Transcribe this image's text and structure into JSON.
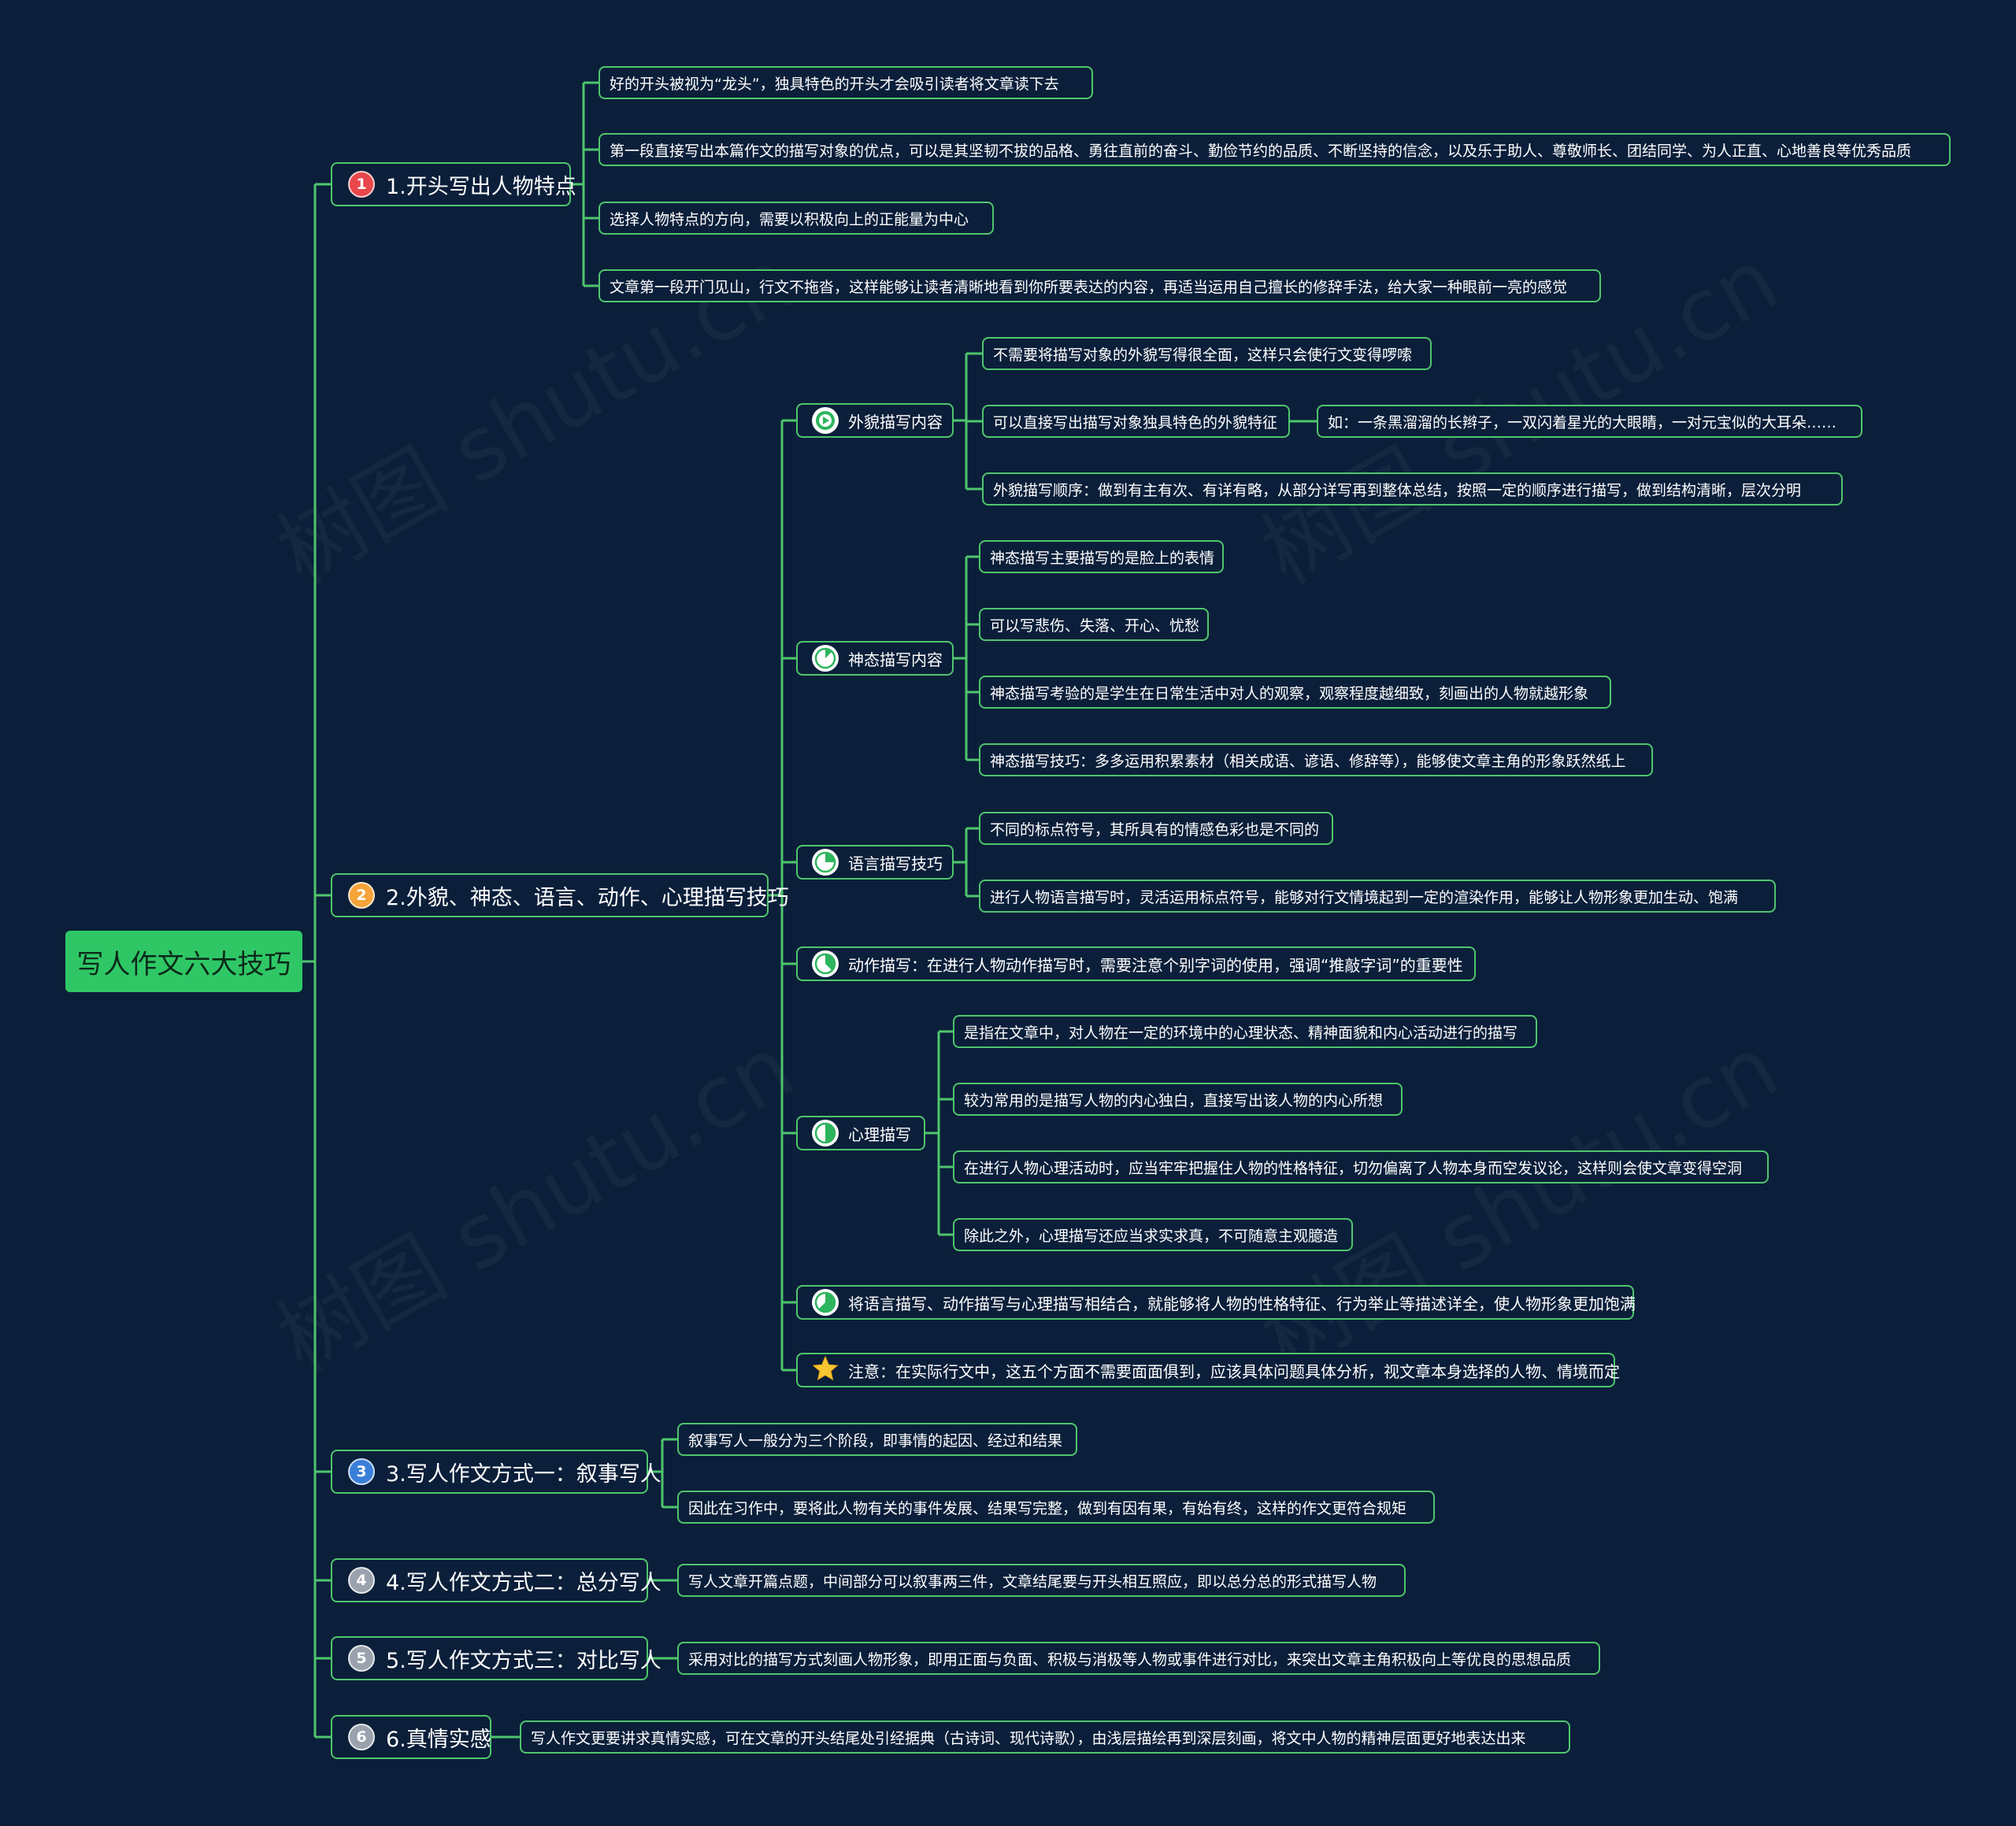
{
  "colors": {
    "background": "#0b1f3a",
    "line": "#4fc56d",
    "root_fill": "#2fc766"
  },
  "watermark": "树图 shutu.cn",
  "root": {
    "label": "写人作文六大技巧"
  },
  "branches": [
    {
      "number": "1",
      "label": "1.开头写出人物特点",
      "marker_color": "#e8474c",
      "items": [
        "好的开头被视为“龙头”，独具特色的开头才会吸引读者将文章读下去",
        "第一段直接写出本篇作文的描写对象的优点，可以是其坚韧不拔的品格、勇往直前的奋斗、勤俭节约的品质、不断坚持的信念，以及乐于助人、尊敬师长、团结同学、为人正直、心地善良等优秀品质",
        "选择人物特点的方向，需要以积极向上的正能量为中心",
        "文章第一段开门见山，行文不拖沓，这样能够让读者清晰地看到你所要表达的内容，再适当运用自己擅长的修辞手法，给大家一种眼前一亮的感觉"
      ]
    },
    {
      "number": "2",
      "label": "2.外貌、神态、语言、动作、心理描写技巧",
      "marker_color": "#f5a33a",
      "subs": [
        {
          "icon": "play-icon",
          "label": "外貌描写内容",
          "items": [
            "不需要将描写对象的外貌写得很全面，这样只会使行文变得啰嗦",
            "可以直接写出描写对象独具特色的外貌特征",
            "外貌描写顺序：做到有主有次、有详有略，从部分详写再到整体总结，按照一定的顺序进行描写，做到结构清晰，层次分明"
          ],
          "example": "如：一条黑溜溜的长辫子，一双闪着星光的大眼睛，一对元宝似的大耳朵……"
        },
        {
          "icon": "progress-1-8-icon",
          "label": "神态描写内容",
          "items": [
            "神态描写主要描写的是脸上的表情",
            "可以写悲伤、失落、开心、忧愁",
            "神态描写考验的是学生在日常生活中对人的观察，观察程度越细致，刻画出的人物就越形象",
            "神态描写技巧：多多运用积累素材（相关成语、谚语、修辞等），能够使文章主角的形象跃然纸上"
          ]
        },
        {
          "icon": "progress-quarter-icon",
          "label": "语言描写技巧",
          "items": [
            "不同的标点符号，其所具有的情感色彩也是不同的",
            "进行人物语言描写时，灵活运用标点符号，能够对行文情境起到一定的渲染作用，能够让人物形象更加生动、饱满"
          ]
        },
        {
          "icon": "progress-3-8-icon",
          "label": "动作描写：在进行人物动作描写时，需要注意个别字词的使用，强调“推敲字词”的重要性",
          "items": []
        },
        {
          "icon": "progress-half-icon",
          "label": "心理描写",
          "items": [
            "是指在文章中，对人物在一定的环境中的心理状态、精神面貌和内心活动进行的描写",
            "较为常用的是描写人物的内心独白，直接写出该人物的内心所想",
            "在进行人物心理活动时，应当牢牢把握住人物的性格特征，切勿偏离了人物本身而空发议论，这样则会使文章变得空洞",
            "除此之外，心理描写还应当求实求真，不可随意主观臆造"
          ]
        },
        {
          "icon": "progress-5-8-icon",
          "label": "将语言描写、动作描写与心理描写相结合，就能够将人物的性格特征、行为举止等描述详全，使人物形象更加饱满",
          "items": []
        },
        {
          "icon": "star-icon",
          "label": "注意：在实际行文中，这五个方面不需要面面俱到，应该具体问题具体分析，视文章本身选择的人物、情境而定",
          "items": []
        }
      ]
    },
    {
      "number": "3",
      "label": "3.写人作文方式一：叙事写人",
      "marker_color": "#3a7fd8",
      "items": [
        "叙事写人一般分为三个阶段，即事情的起因、经过和结果",
        "因此在习作中，要将此人物有关的事件发展、结果写完整，做到有因有果，有始有终，这样的作文更符合规矩"
      ]
    },
    {
      "number": "4",
      "label": "4.写人作文方式二：总分写人",
      "marker_color": "#9aa3ad",
      "items": [
        "写人文章开篇点题，中间部分可以叙事两三件，文章结尾要与开头相互照应，即以总分总的形式描写人物"
      ]
    },
    {
      "number": "5",
      "label": "5.写人作文方式三：对比写人",
      "marker_color": "#9aa3ad",
      "items": [
        "采用对比的描写方式刻画人物形象，即用正面与负面、积极与消极等人物或事件进行对比，来突出文章主角积极向上等优良的思想品质"
      ]
    },
    {
      "number": "6",
      "label": "6.真情实感",
      "marker_color": "#9aa3ad",
      "items": [
        "写人作文更要讲求真情实感，可在文章的开头结尾处引经据典（古诗词、现代诗歌），由浅层描绘再到深层刻画，将文中人物的精神层面更好地表达出来"
      ]
    }
  ]
}
